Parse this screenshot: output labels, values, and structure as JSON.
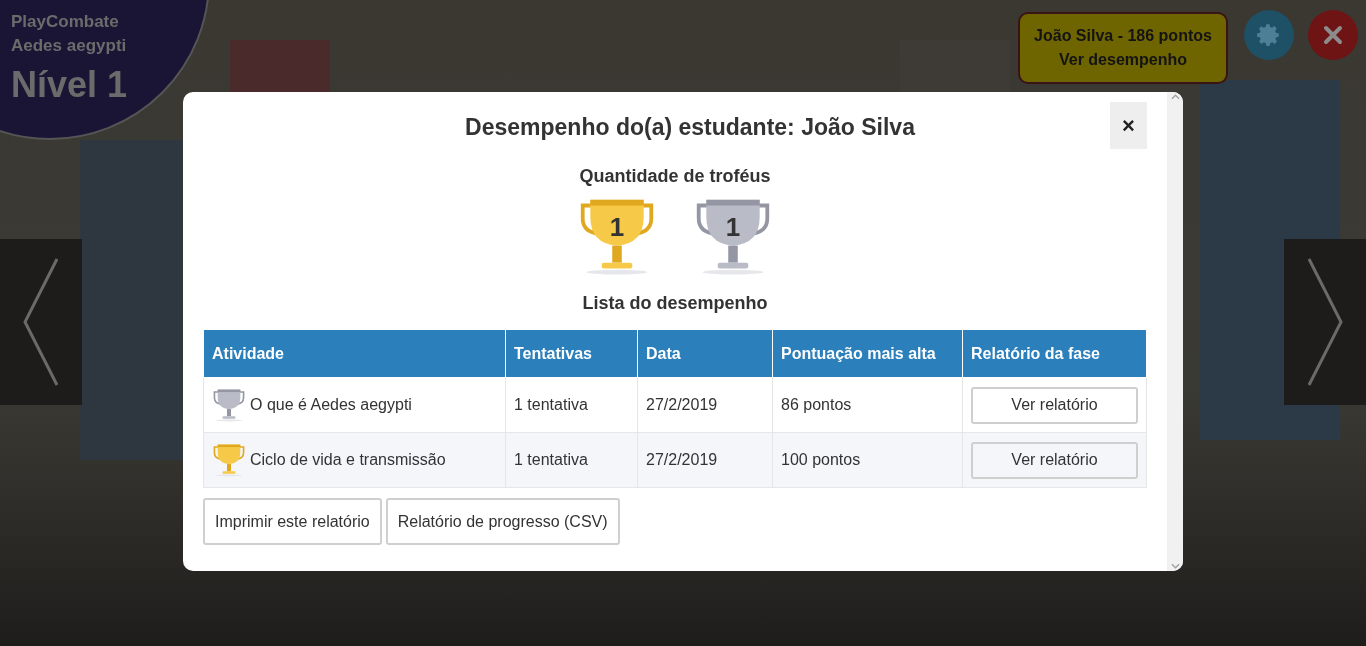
{
  "game": {
    "title": "PlayCombate",
    "subtitle": "Aedes aegypti",
    "level": "Nível 1"
  },
  "player_button": {
    "line_1": "João Silva - 186 pontos",
    "line_2": "Ver desempenho"
  },
  "dialog": {
    "title": "Desempenho do(a) estudante: João Silva",
    "close": "×",
    "trophies_heading": "Quantidade de troféus",
    "trophies": [
      {
        "kind": "gold",
        "count": "1"
      },
      {
        "kind": "silver",
        "count": "1"
      }
    ],
    "list_heading": "Lista do desempenho",
    "table": {
      "columns": [
        "Atividade",
        "Tentativas",
        "Data",
        "Pontuação mais alta",
        "Relatório da fase"
      ],
      "rows": [
        {
          "kind": "silver",
          "activity": "O que é Aedes aegypti",
          "attempts": "1 tentativa",
          "date": "27/2/2019",
          "score": "86 pontos",
          "report": "Ver relatório"
        },
        {
          "kind": "gold",
          "activity": "Ciclo de vida e transmissão",
          "attempts": "1 tentativa",
          "date": "27/2/2019",
          "score": "100 pontos",
          "report": "Ver relatório"
        }
      ]
    },
    "buttons": [
      "Imprimir este relatório",
      "Relatório de progresso (CSV)"
    ]
  }
}
